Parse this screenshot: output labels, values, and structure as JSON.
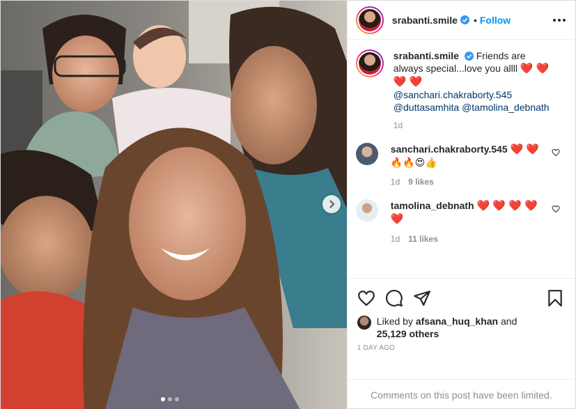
{
  "post_header": {
    "username": "srabanti.smile",
    "bullet": "•",
    "follow_label": "Follow"
  },
  "caption": {
    "username": "srabanti.smile",
    "text": "Friends are always special...love you allll",
    "hearts": "❤️ ❤️ ❤️ ❤️",
    "mentions": [
      "@sanchari.chakraborty.545",
      "@duttasamhita",
      "@tamolina_debnath"
    ],
    "time": "1d"
  },
  "comments": [
    {
      "username": "sanchari.chakraborty.545",
      "text_line1": "❤️ ❤️",
      "text_line2": "🔥🔥😍👍",
      "time": "1d",
      "likes": "9 likes"
    },
    {
      "username": "tamolina_debnath",
      "text_line1": "❤️ ❤️ ❤️ ❤️",
      "text_line2": "❤️",
      "time": "1d",
      "likes": "11 likes"
    }
  ],
  "likes": {
    "prefix": "Liked by",
    "user": "afsana_huq_khan",
    "and": "and",
    "others": "25,129 others"
  },
  "posted_ago": "1 DAY AGO",
  "comments_limited": "Comments on this post have been limited.",
  "carousel": {
    "total": 3,
    "active": 1
  },
  "colors": {
    "follow": "#0095f6",
    "mention": "#00376b",
    "muted": "#8e8e8e",
    "heart": "#ed1b24"
  },
  "icons": [
    "verified-icon",
    "more-options-icon",
    "heart-icon",
    "comment-icon",
    "share-icon",
    "bookmark-icon",
    "chevron-right-icon"
  ]
}
